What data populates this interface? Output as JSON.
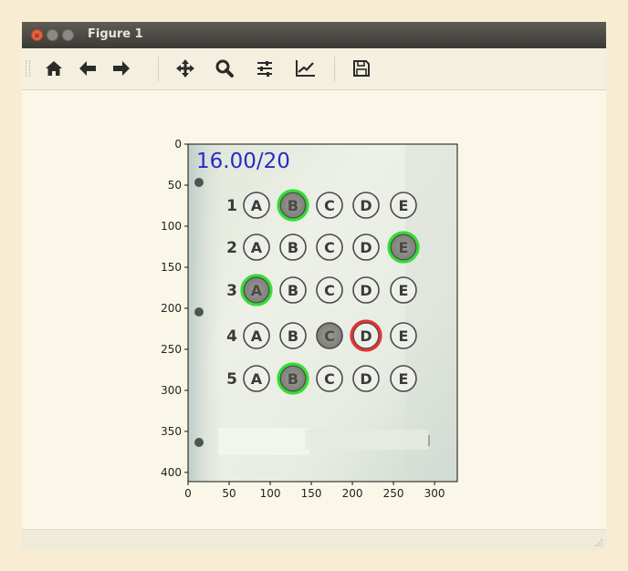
{
  "window": {
    "title": "Figure 1"
  },
  "toolbar": {
    "buttons": [
      {
        "name": "home-button",
        "icon": "home-icon"
      },
      {
        "name": "back-button",
        "icon": "arrow-left-icon"
      },
      {
        "name": "forward-button",
        "icon": "arrow-right-icon"
      },
      {
        "name": "pan-button",
        "icon": "move-icon"
      },
      {
        "name": "zoom-button",
        "icon": "magnifier-icon"
      },
      {
        "name": "subplots-button",
        "icon": "sliders-icon"
      },
      {
        "name": "edit-axes-button",
        "icon": "line-chart-icon"
      },
      {
        "name": "save-button",
        "icon": "floppy-disk-icon"
      }
    ]
  },
  "figure": {
    "score_text": "16.00/20",
    "x_ticks": [
      "0",
      "50",
      "100",
      "150",
      "200",
      "250",
      "300"
    ],
    "y_ticks": [
      "0",
      "50",
      "100",
      "150",
      "200",
      "250",
      "300",
      "350",
      "400"
    ],
    "rows": [
      {
        "number": "1",
        "options": [
          "A",
          "B",
          "C",
          "D",
          "E"
        ],
        "filled": "B",
        "marks": {
          "B": "correct"
        }
      },
      {
        "number": "2",
        "options": [
          "A",
          "B",
          "C",
          "D",
          "E"
        ],
        "filled": "E",
        "marks": {
          "E": "correct"
        }
      },
      {
        "number": "3",
        "options": [
          "A",
          "B",
          "C",
          "D",
          "E"
        ],
        "filled": "A",
        "marks": {
          "A": "correct"
        }
      },
      {
        "number": "4",
        "options": [
          "A",
          "B",
          "C",
          "D",
          "E"
        ],
        "filled": "C",
        "marks": {
          "D": "wrong"
        }
      },
      {
        "number": "5",
        "options": [
          "A",
          "B",
          "C",
          "D",
          "E"
        ],
        "filled": "B",
        "marks": {
          "B": "correct"
        }
      }
    ],
    "colors": {
      "correct": "#33dd33",
      "wrong": "#e53333",
      "score": "#2b2bc8"
    }
  }
}
